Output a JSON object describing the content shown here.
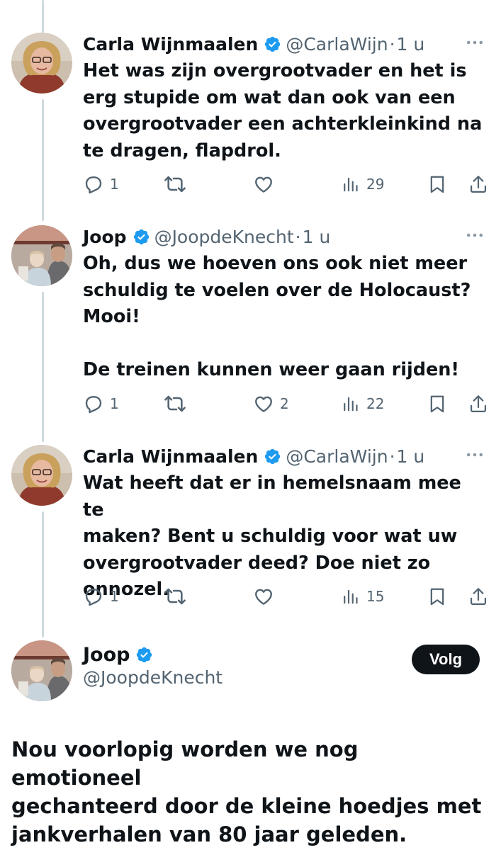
{
  "tweets": [
    {
      "name": "Carla Wijnmaalen",
      "handle": "@CarlaWijn",
      "sep": "·",
      "time": "1 u",
      "text": "Het was zijn overgrootvader en het is\nerg stupide om wat dan ook van een\novergrootvader een achterkleinkind na\nte dragen, flapdrol.",
      "replies": "1",
      "retweets": "",
      "likes": "",
      "views": "29"
    },
    {
      "name": "Joop",
      "handle": "@JoopdeKnecht",
      "sep": "·",
      "time": "1 u",
      "text": "Oh, dus we hoeven ons ook niet meer\nschuldig te voelen over de Holocaust?\nMooi!\n\nDe treinen kunnen weer gaan rijden!",
      "replies": "1",
      "retweets": "",
      "likes": "2",
      "views": "22"
    },
    {
      "name": "Carla Wijnmaalen",
      "handle": "@CarlaWijn",
      "sep": "·",
      "time": "1 u",
      "text": "Wat heeft dat er in hemelsnaam mee te\nmaken? Bent u schuldig voor wat uw\novergrootvader deed? Doe niet zo\nonnozel.",
      "replies": "1",
      "retweets": "",
      "likes": "",
      "views": "15"
    }
  ],
  "main_tweet": {
    "name": "Joop",
    "handle": "@JoopdeKnecht",
    "follow_label": "Volg",
    "text": "Nou voorlopig worden we nog emotioneel\ngechanteerd door de kleine hoedjes met\njankverhalen van 80 jaar geleden."
  },
  "colors": {
    "verified": "#1d9bf0",
    "secondary_text": "#536471",
    "thread_line": "#cfd9de",
    "follow_button": "#0f1419"
  },
  "icons": {
    "verified": "verified-badge-icon",
    "more": "more-dots-icon",
    "reply": "reply-icon",
    "retweet": "retweet-icon",
    "like": "heart-icon",
    "views": "views-icon",
    "bookmark": "bookmark-icon",
    "share": "share-icon"
  }
}
